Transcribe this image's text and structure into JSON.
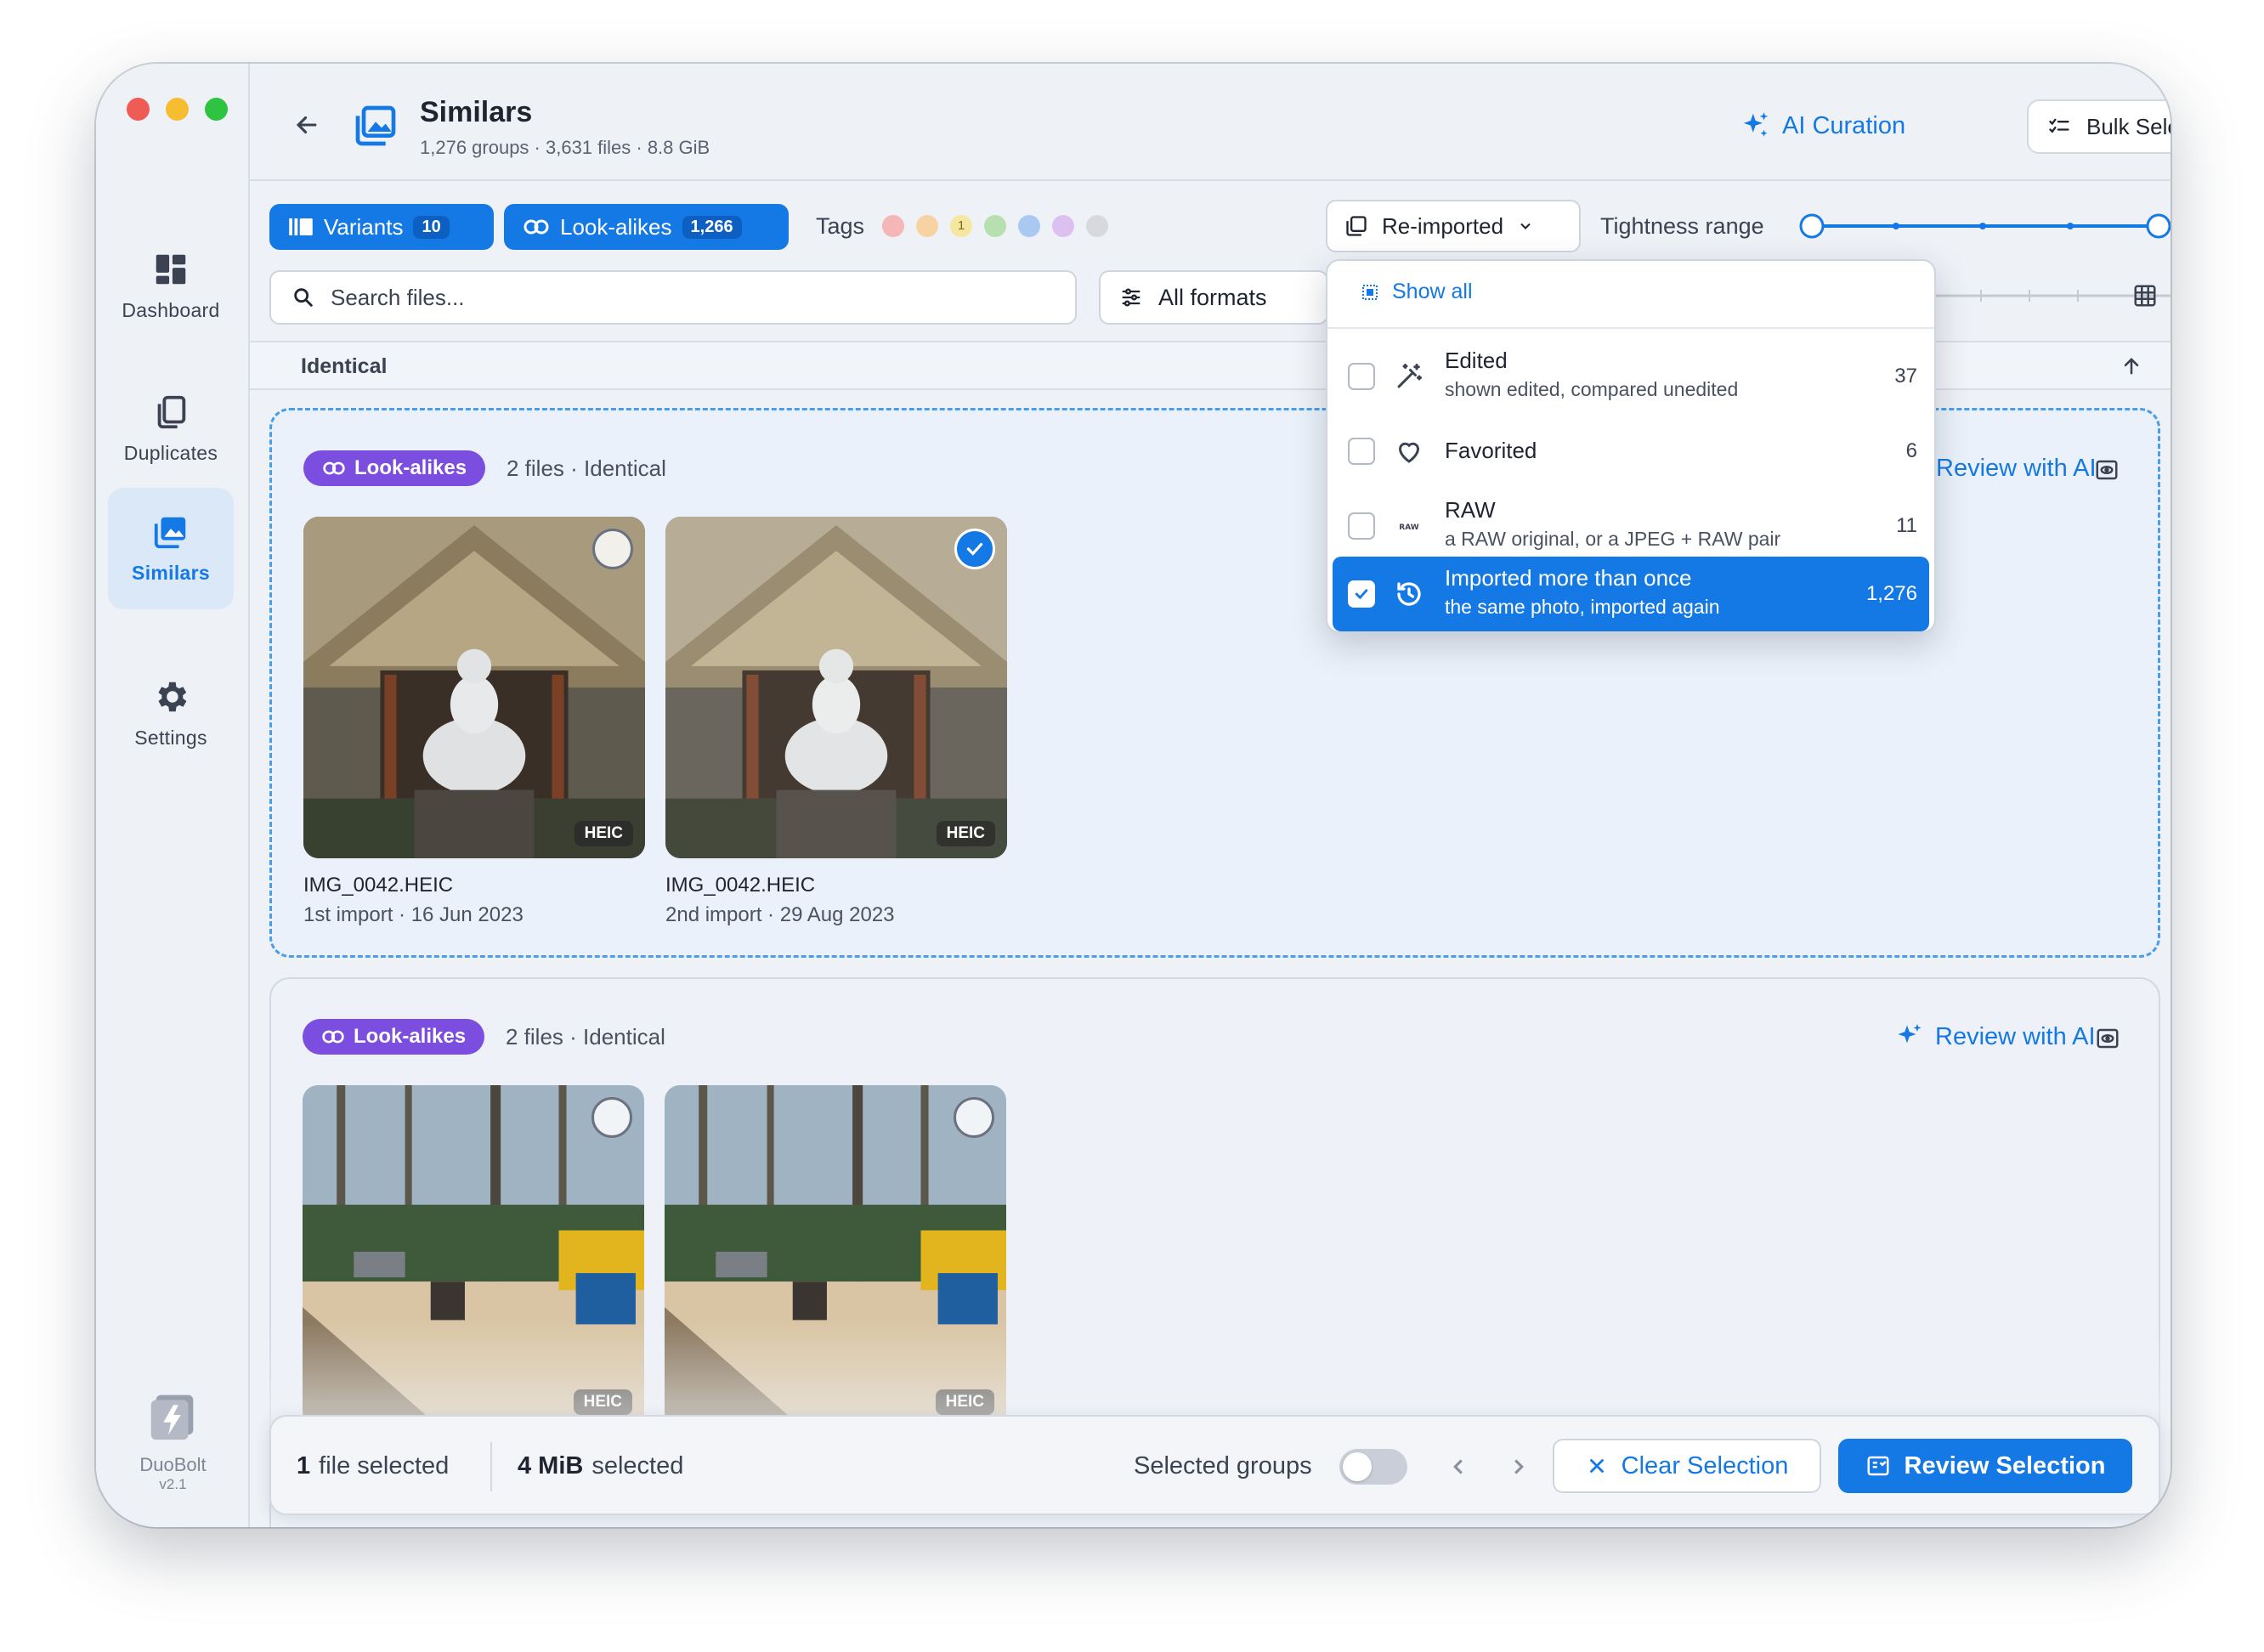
{
  "sidebar": {
    "items": [
      {
        "label": "Dashboard",
        "icon": "dashboard-icon"
      },
      {
        "label": "Duplicates",
        "icon": "duplicates-icon"
      },
      {
        "label": "Similars",
        "icon": "similars-icon",
        "active": true
      },
      {
        "label": "Settings",
        "icon": "gear-icon"
      }
    ],
    "brand": {
      "name": "DuoBolt",
      "version": "v2.1"
    }
  },
  "header": {
    "title": "Similars",
    "subtitle": "1,276 groups · 3,631 files · 8.8 GiB",
    "ai_curation": "AI Curation",
    "bulk_select": "Bulk Select"
  },
  "toolbar": {
    "variants_label": "Variants",
    "variants_count": "10",
    "lookalikes_label": "Look-alikes",
    "lookalikes_count": "1,266",
    "tags_label": "Tags",
    "tag_count": "1",
    "tag_colors": [
      "#f4b6b6",
      "#f7d3a3",
      "#f5e7a0",
      "#b7e0b0",
      "#a9c8f2",
      "#dcc0f0",
      "#d7d9de"
    ],
    "reimported_label": "Re-imported",
    "tightness_label": "Tightness range",
    "search_placeholder": "Search files...",
    "formats_label": "All formats"
  },
  "section": {
    "label": "Identical"
  },
  "groups": [
    {
      "badge": "Look-alikes",
      "meta": "2 files · Identical",
      "review_label": "Review with AI",
      "files": [
        {
          "name": "IMG_0042.HEIC",
          "date": "1st import · 16 Jun 2023",
          "format": "HEIC",
          "selected": false
        },
        {
          "name": "IMG_0042.HEIC",
          "date": "2nd import · 29 Aug 2023",
          "format": "HEIC",
          "selected": true
        }
      ]
    },
    {
      "badge": "Look-alikes",
      "meta": "2 files · Identical",
      "review_label": "Review with AI",
      "files": [
        {
          "format": "HEIC",
          "selected": false
        },
        {
          "format": "HEIC",
          "selected": false
        }
      ]
    }
  ],
  "dropdown": {
    "show_all": "Show all",
    "options": [
      {
        "title": "Edited",
        "subtitle": "shown edited, compared unedited",
        "count": "37",
        "checked": false,
        "icon": "magic-wand-icon"
      },
      {
        "title": "Favorited",
        "subtitle": "",
        "count": "6",
        "checked": false,
        "icon": "heart-icon"
      },
      {
        "title": "RAW",
        "subtitle": "a RAW original, or a JPEG + RAW pair",
        "count": "11",
        "checked": false,
        "icon": "raw-icon",
        "icon_text": "RAW"
      },
      {
        "title": "Imported more than once",
        "subtitle": "the same photo, imported again",
        "count": "1,276",
        "checked": true,
        "icon": "history-icon"
      }
    ]
  },
  "bottom_bar": {
    "file_count": "1",
    "file_label": "file selected",
    "size_value": "4 MiB",
    "size_label": "selected",
    "groups_toggle_label": "Selected groups",
    "clear_label": "Clear Selection",
    "review_label": "Review Selection"
  },
  "colors": {
    "accent": "#1479e5",
    "badge": "#7b4ee0"
  }
}
